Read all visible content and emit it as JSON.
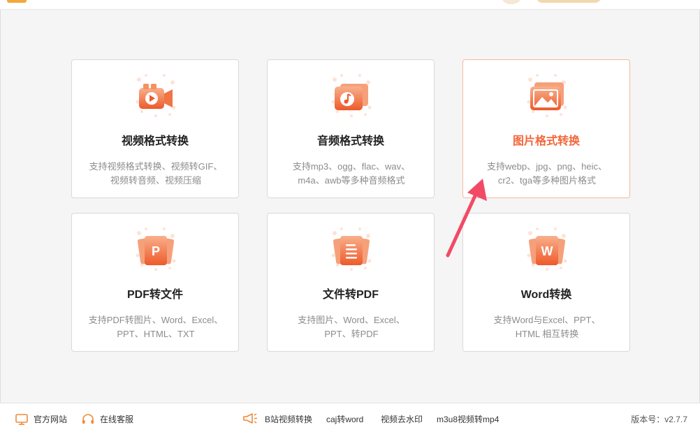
{
  "cards": [
    {
      "title": "视频格式转换",
      "desc1": "支持视频格式转换、视频转GIF、",
      "desc2": "视频转音频、视频压缩",
      "icon": "video-camera-icon"
    },
    {
      "title": "音频格式转换",
      "desc1": "支持mp3、ogg、flac、wav、",
      "desc2": "m4a、awb等多种音频格式",
      "icon": "music-note-icon"
    },
    {
      "title": "图片格式转换",
      "desc1": "支持webp、jpg、png、heic、",
      "desc2": "cr2、tga等多种图片格式",
      "icon": "image-icon"
    },
    {
      "title": "PDF转文件",
      "desc1": "支持PDF转图片、Word、Excel、",
      "desc2": "PPT、HTML、TXT",
      "icon": "pdf-icon",
      "letter": "P"
    },
    {
      "title": "文件转PDF",
      "desc1": "支持图片、Word、Excel、",
      "desc2": "PPT、转PDF",
      "icon": "document-icon"
    },
    {
      "title": "Word转换",
      "desc1": "支持Word与Excel、PPT、",
      "desc2": "HTML 相互转换",
      "icon": "word-icon",
      "letter": "W"
    }
  ],
  "footer": {
    "website": "官方网站",
    "service": "在线客服",
    "links": [
      "B站视频转换",
      "caj转word",
      "视频去水印",
      "m3u8视频转mp4"
    ],
    "version": "版本号：v2.7.7"
  },
  "colors": {
    "accent": "#f2663a",
    "icon_gradient_top": "#f6a07a",
    "icon_gradient_bottom": "#ef5a2c",
    "active_border": "#f7b8a0",
    "arrow": "#f24a66"
  }
}
